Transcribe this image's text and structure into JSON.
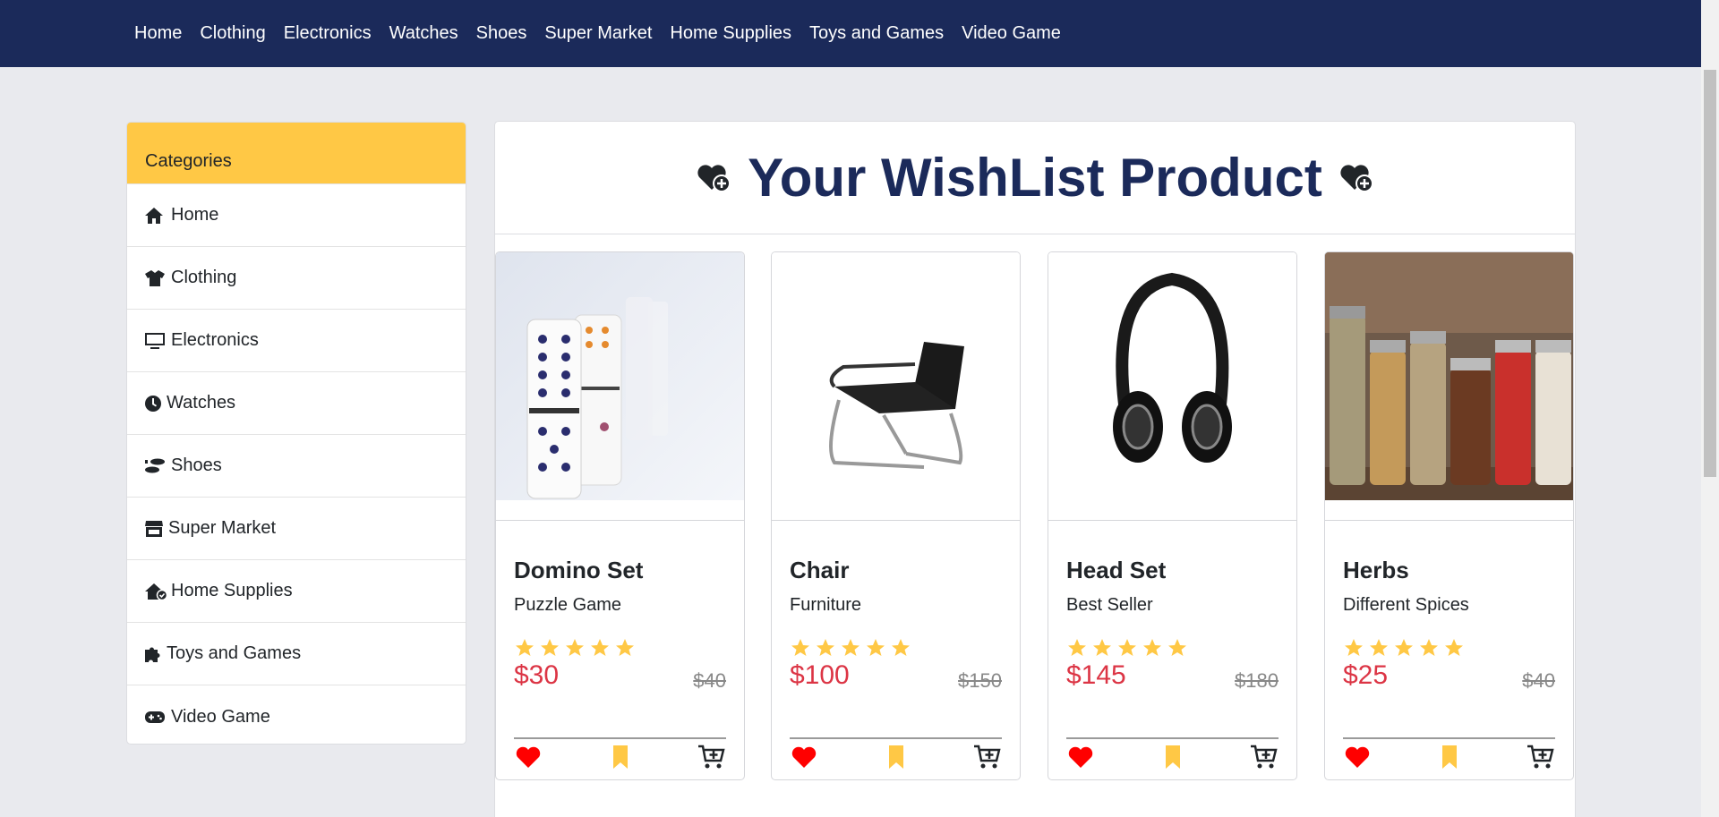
{
  "nav": {
    "items": [
      "Home",
      "Clothing",
      "Electronics",
      "Watches",
      "Shoes",
      "Super Market",
      "Home Supplies",
      "Toys and Games",
      "Video Game"
    ]
  },
  "sidebar": {
    "header": "Categories",
    "items": [
      {
        "label": "Home",
        "icon": "house-icon"
      },
      {
        "label": "Clothing",
        "icon": "shirt-icon"
      },
      {
        "label": "Electronics",
        "icon": "monitor-icon"
      },
      {
        "label": "Watches",
        "icon": "clock-icon"
      },
      {
        "label": "Shoes",
        "icon": "shoe-prints-icon"
      },
      {
        "label": "Super Market",
        "icon": "shop-icon"
      },
      {
        "label": "Home Supplies",
        "icon": "house-check-icon"
      },
      {
        "label": "Toys and Games",
        "icon": "puzzle-icon"
      },
      {
        "label": "Video Game",
        "icon": "gamepad-icon"
      }
    ]
  },
  "main": {
    "title": "Your WishList Product",
    "products": [
      {
        "name": "Domino Set",
        "subtitle": "Puzzle Game",
        "price": "$30",
        "old_price": "$40",
        "rating": 5
      },
      {
        "name": "Chair",
        "subtitle": "Furniture",
        "price": "$100",
        "old_price": "$150",
        "rating": 5
      },
      {
        "name": "Head Set",
        "subtitle": "Best Seller",
        "price": "$145",
        "old_price": "$180",
        "rating": 5
      },
      {
        "name": "Herbs",
        "subtitle": "Different Spices",
        "price": "$25",
        "old_price": "$40",
        "rating": 5
      }
    ]
  },
  "colors": {
    "nav_bg": "#1b2a5a",
    "category_header": "#ffc845",
    "price": "#dc3545",
    "star": "#ffc845",
    "heart": "#ff0000",
    "bookmark": "#ffc845"
  }
}
